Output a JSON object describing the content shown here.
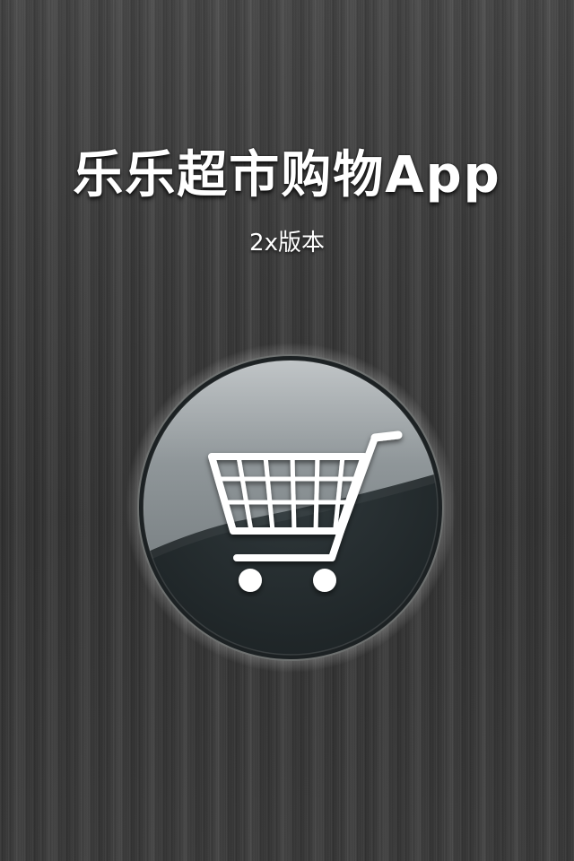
{
  "splash": {
    "title": "乐乐超市购物App",
    "subtitle": "2x版本"
  },
  "logo": {
    "icon": "shopping-cart-icon"
  },
  "colors": {
    "background": "#3a3a3a",
    "text": "#ffffff",
    "cart": "#ffffff",
    "button_dark": "#22282a",
    "button_glow": "#fff8dc"
  }
}
